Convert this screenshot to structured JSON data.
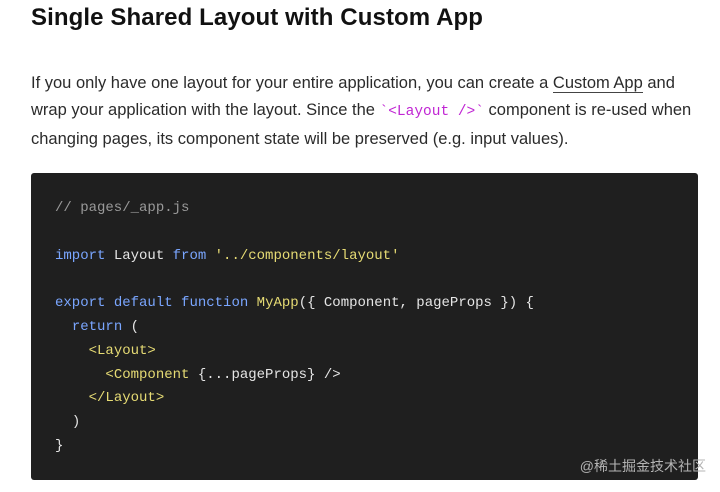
{
  "heading": "Single Shared Layout with Custom App",
  "paragraph": {
    "part1": "If you only have one layout for your entire application, you can create a ",
    "link_text": "Custom App",
    "part2": " and wrap your application with the layout. Since the ",
    "inline_code": "`<Layout />`",
    "part3": " component is re-used when changing pages, its component state will be preserved (e.g. input values)."
  },
  "code": {
    "comment": "// pages/_app.js",
    "kw_import": "import",
    "import_name": " Layout ",
    "kw_from": "from",
    "import_path": " '../components/layout'",
    "kw_export": "export",
    "kw_default": "default",
    "kw_function": "function",
    "fn_name": "MyApp",
    "fn_params": "({ Component, pageProps }) {",
    "kw_return": "return",
    "return_paren": " (",
    "open_tag": "<Layout>",
    "component_tag_name": "<Component",
    "component_props": " {...pageProps} ",
    "component_close": "/>",
    "close_tag": "</Layout>",
    "close_paren": ")",
    "close_brace": "}"
  },
  "watermark": "@稀土掘金技术社区"
}
